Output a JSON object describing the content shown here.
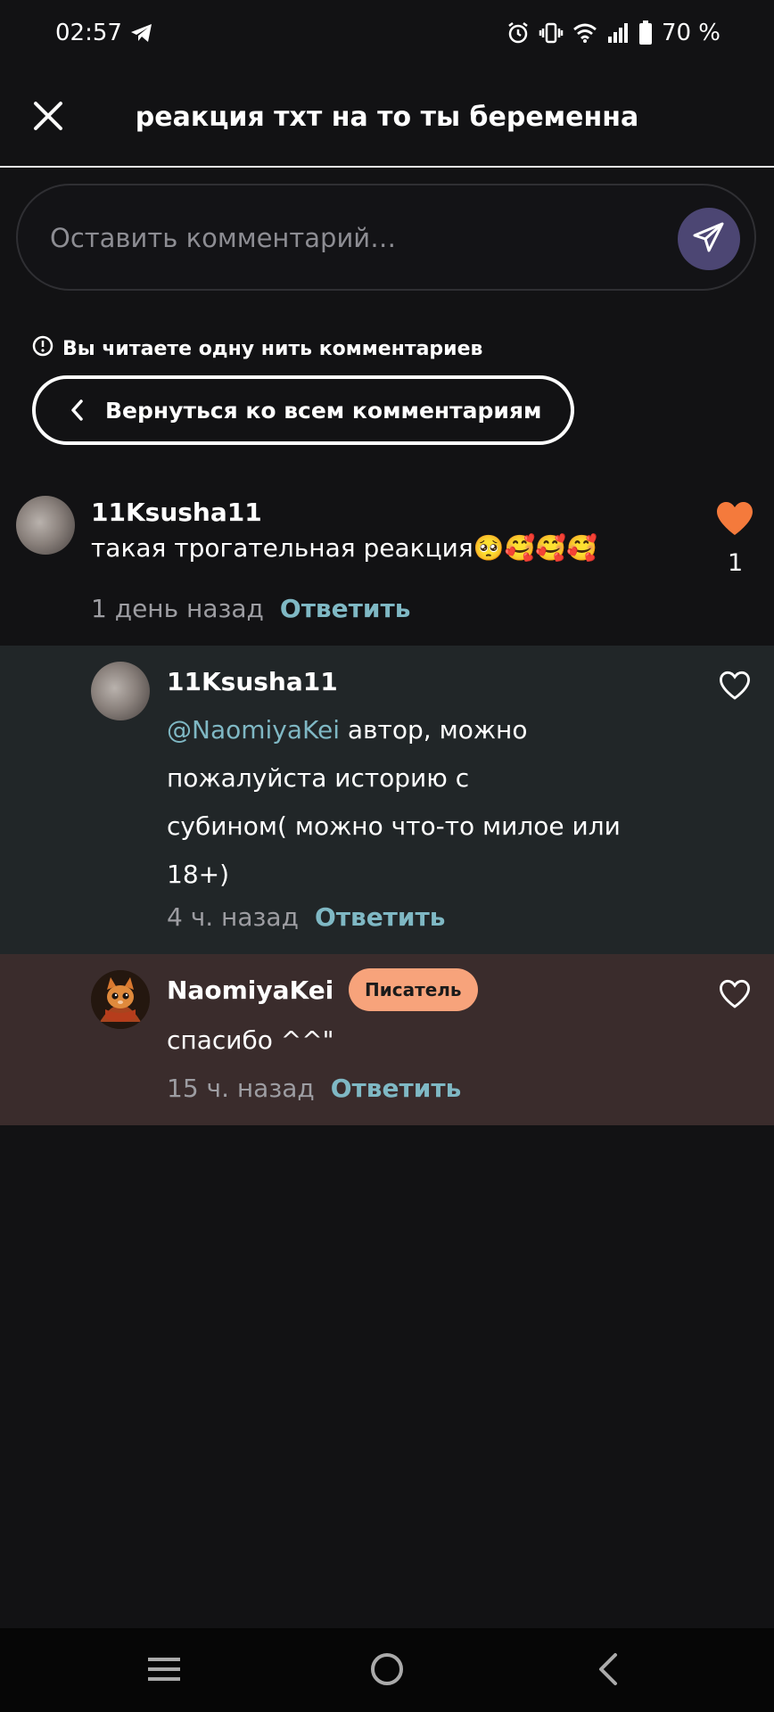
{
  "status_bar": {
    "time": "02:57",
    "battery": "70 %",
    "icons": [
      "telegram-icon",
      "alarm-icon",
      "vibrate-icon",
      "wifi-icon",
      "signal-icon",
      "battery-icon"
    ]
  },
  "header": {
    "title": "реакция тхт на то ты беременна",
    "close_icon": "close-icon"
  },
  "comment_input": {
    "placeholder": "Оставить комментарий…",
    "send_icon": "send-icon"
  },
  "thread": {
    "notice": "Вы читаете одну нить комментариев",
    "back_label": "Вернуться ко всем комментариям"
  },
  "comments": [
    {
      "author": "11Ksusha11",
      "text": "такая трогательная реакция🥺🥰🥰🥰",
      "time": "1 день назад",
      "reply_label": "Ответить",
      "liked": true,
      "likes": "1"
    },
    {
      "author": "11Ksusha11",
      "mention": "@NaomiyaKei",
      "text_line1": " автор, можно",
      "text_line2": "пожалуйста историю с",
      "text_line3": "субином( можно что-то милое или",
      "text_line4": "18+)",
      "time": "4 ч. назад",
      "reply_label": "Ответить",
      "liked": false
    },
    {
      "author": "NaomiyaKei",
      "badge": "Писатель",
      "text": "спасибо ^^\"",
      "time": "15 ч. назад",
      "reply_label": "Ответить",
      "liked": false
    }
  ],
  "colors": {
    "background": "#121214",
    "accent_link": "#7fb8c4",
    "heart_active": "#f47a3c",
    "badge": "#f7a37b",
    "reply_bg": "#212628",
    "author_bg": "#3a2c2c"
  }
}
